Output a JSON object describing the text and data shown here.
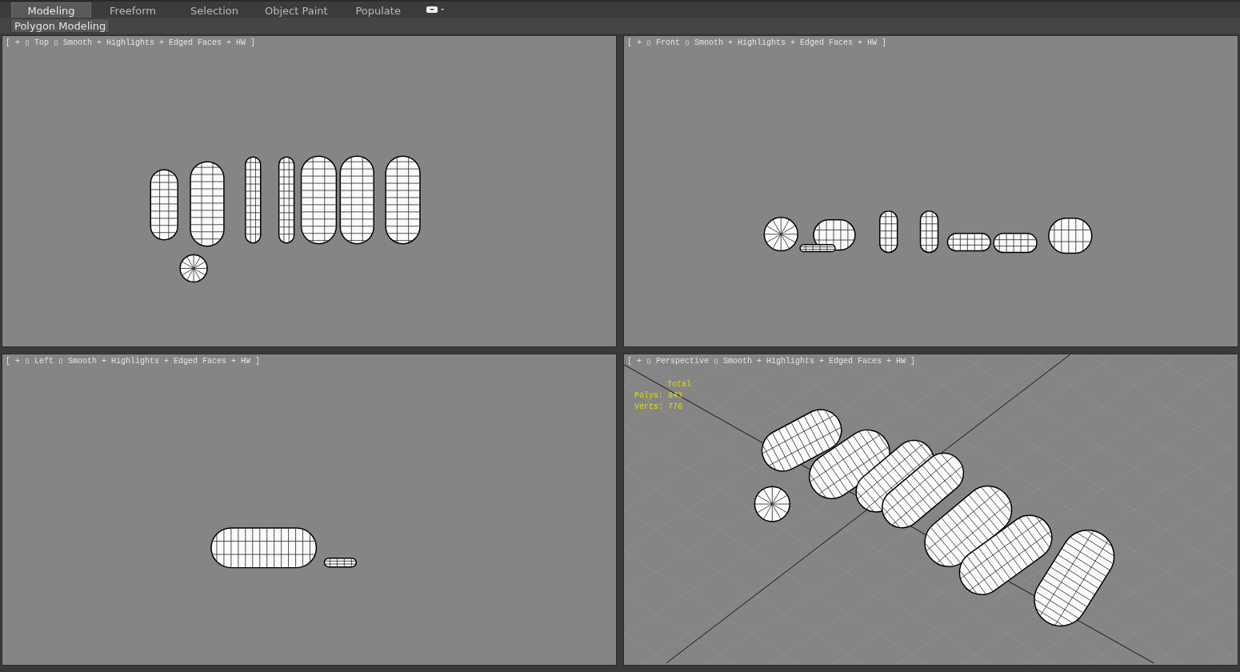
{
  "tabs": [
    {
      "label": "Modeling",
      "selected": true
    },
    {
      "label": "Freeform",
      "selected": false
    },
    {
      "label": "Selection",
      "selected": false
    },
    {
      "label": "Object Paint",
      "selected": false
    },
    {
      "label": "Populate",
      "selected": false
    }
  ],
  "ribbon": {
    "panel": "Polygon Modeling"
  },
  "viewports": [
    {
      "kind": "top",
      "label": "[ + ▯ Top ▯ Smooth + Highlights + Edged Faces + HW ]"
    },
    {
      "kind": "front",
      "label": "[ + ▯ Front ▯ Smooth + Highlights + Edged Faces + HW ]"
    },
    {
      "kind": "left",
      "label": "[ + ▯ Left ▯ Smooth + Highlights + Edged Faces + HW ]"
    },
    {
      "kind": "perspective",
      "label": "[ + ▯ Perspective ▯ Smooth + Highlights + Edged Faces + HW ]",
      "stats": {
        "title": "Total",
        "polys": "Polys:  843",
        "verts": "Verts:  776"
      }
    }
  ]
}
